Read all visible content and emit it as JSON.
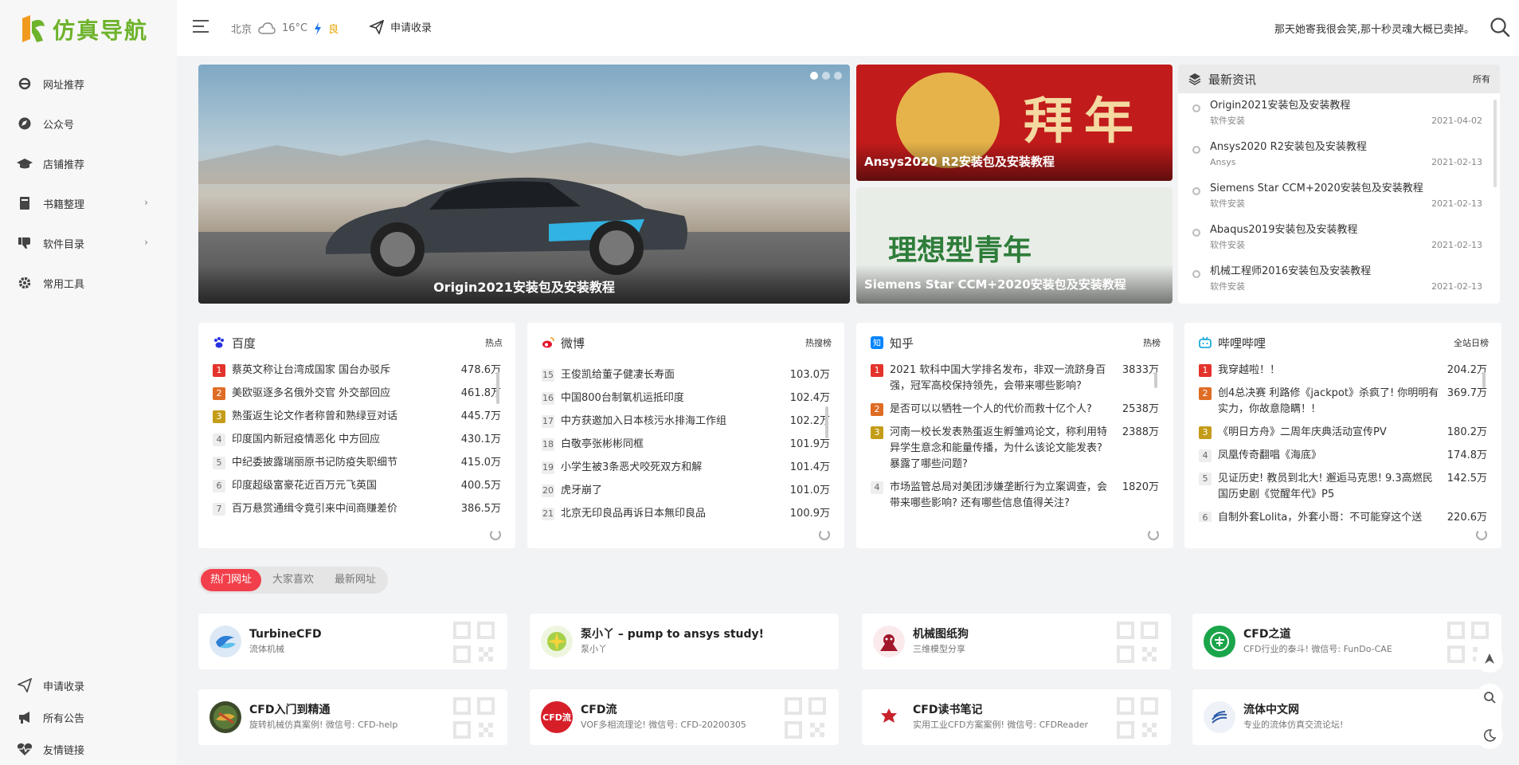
{
  "brand": {
    "name": "仿真导航"
  },
  "sidebar": {
    "items": [
      {
        "label": "网址推荐",
        "icon": "ie-icon"
      },
      {
        "label": "公众号",
        "icon": "compass-icon"
      },
      {
        "label": "店铺推荐",
        "icon": "graduation-cap-icon"
      },
      {
        "label": "书籍整理",
        "icon": "book-icon",
        "chevron": true
      },
      {
        "label": "软件目录",
        "icon": "thumbs-down-icon",
        "chevron": true
      },
      {
        "label": "常用工具",
        "icon": "gear-icon"
      }
    ],
    "bottom": [
      {
        "label": "申请收录",
        "icon": "paper-plane-icon"
      },
      {
        "label": "所有公告",
        "icon": "bullhorn-icon"
      },
      {
        "label": "友情链接",
        "icon": "heartbeat-icon"
      }
    ]
  },
  "header": {
    "city": "北京",
    "temp": "16°C",
    "air": "良",
    "apply": "申请收录",
    "quote": "那天她寄我很会笑,那十秒灵魂大概已卖掉。"
  },
  "hero": {
    "slide_caption": "Origin2021安装包及安装教程",
    "tile1_caption": "Ansys2020 R2安装包及安装教程",
    "tile1_art": "拜年",
    "tile2_caption": "Siemens Star CCM+2020安装包及安装教程",
    "tile2_art": "理想型青年"
  },
  "news": {
    "title": "最新资讯",
    "more": "所有",
    "items": [
      {
        "title": "Origin2021安装包及安装教程",
        "cat": "软件安装",
        "date": "2021-04-02"
      },
      {
        "title": "Ansys2020 R2安装包及安装教程",
        "cat": "Ansys",
        "date": "2021-02-13"
      },
      {
        "title": "Siemens Star CCM+2020安装包及安装教程",
        "cat": "软件安装",
        "date": "2021-02-13"
      },
      {
        "title": "Abaqus2019安装包及安装教程",
        "cat": "软件安装",
        "date": "2021-02-13"
      },
      {
        "title": "机械工程师2016安装包及安装教程",
        "cat": "软件安装",
        "date": "2021-02-13"
      }
    ]
  },
  "boards": [
    {
      "name": "百度",
      "tag": "热点",
      "color": "#2932e1",
      "rows": [
        {
          "n": "1",
          "t": "蔡英文称让台湾成国家 国台办驳斥",
          "v": "478.6万"
        },
        {
          "n": "2",
          "t": "美欧驱逐多名俄外交官 外交部回应",
          "v": "461.8万"
        },
        {
          "n": "3",
          "t": "熟蛋返生论文作者称曾和熟绿豆对话",
          "v": "445.7万"
        },
        {
          "n": "4",
          "t": "印度国内新冠疫情恶化 中方回应",
          "v": "430.1万"
        },
        {
          "n": "5",
          "t": "中纪委披露瑞丽原书记防疫失职细节",
          "v": "415.0万"
        },
        {
          "n": "6",
          "t": "印度超级富豪花近百万元飞英国",
          "v": "400.5万"
        },
        {
          "n": "7",
          "t": "百万悬赏通缉令竟引来中间商赚差价",
          "v": "386.5万"
        }
      ]
    },
    {
      "name": "微博",
      "tag": "热搜榜",
      "color": "#e6162d",
      "rows": [
        {
          "n": "15",
          "t": "王俊凯给董子健凄长寿面",
          "v": "103.0万"
        },
        {
          "n": "16",
          "t": "中国800台制氧机运抵印度",
          "v": "102.4万"
        },
        {
          "n": "17",
          "t": "中方获邀加入日本核污水排海工作组",
          "v": "102.2万"
        },
        {
          "n": "18",
          "t": "白敬亭张彬彬同框",
          "v": "101.9万"
        },
        {
          "n": "19",
          "t": "小学生被3条恶犬咬死双方和解",
          "v": "101.4万"
        },
        {
          "n": "20",
          "t": "虎牙崩了",
          "v": "101.0万"
        },
        {
          "n": "21",
          "t": "北京无印良品再诉日本無印良品",
          "v": "100.9万"
        }
      ]
    },
    {
      "name": "知乎",
      "tag": "热榜",
      "color": "#0084ff",
      "rows": [
        {
          "n": "1",
          "t": "2021 软科中国大学排名发布，非双一流跻身百强，冠军高校保持领先，会带来哪些影响?",
          "v": "3833万"
        },
        {
          "n": "2",
          "t": "是否可以以牺牲一个人的代价而救十亿个人?",
          "v": "2538万"
        },
        {
          "n": "3",
          "t": "河南一校长发表熟蛋返生孵雏鸡论文，称利用特异学生意念和能量传播，为什么该论文能发表? 暴露了哪些问题?",
          "v": "2388万"
        },
        {
          "n": "4",
          "t": "市场监管总局对美团涉嫌垄断行为立案调查，会带来哪些影响? 还有哪些信息值得关注?",
          "v": "1820万"
        }
      ]
    },
    {
      "name": "哔哩哔哩",
      "tag": "全站日榜",
      "color": "#00a1d6",
      "rows": [
        {
          "n": "1",
          "t": "我穿越啦！！",
          "v": "204.2万"
        },
        {
          "n": "2",
          "t": "创4总决赛 利路修《jackpot》杀疯了! 你明明有实力，你故意隐瞒！!",
          "v": "369.7万"
        },
        {
          "n": "3",
          "t": "《明日方舟》二周年庆典活动宣传PV",
          "v": "180.2万"
        },
        {
          "n": "4",
          "t": "凤凰传奇翻唱《海底》",
          "v": "174.8万"
        },
        {
          "n": "5",
          "t": "见证历史! 教员到北大! 邂逅马克思! 9.3高燃民国历史剧《觉醒年代》P5",
          "v": "142.5万"
        },
        {
          "n": "6",
          "t": "自制外套Lolita，外套小哥：不可能穿这个送",
          "v": "220.6万"
        }
      ]
    }
  ],
  "tabs": [
    "热门网址",
    "大家喜欢",
    "最新网址"
  ],
  "sites": [
    {
      "name": "TurbineCFD",
      "desc": "流体机械",
      "color": "#3a7bd5"
    },
    {
      "name": "泵小丫 – pump to ansys study!",
      "desc": "泵小丫",
      "color": "#8bc34a"
    },
    {
      "name": "机械图纸狗",
      "desc": "三维模型分享",
      "color": "#a0182a"
    },
    {
      "name": "CFD之道",
      "desc": "CFD行业的泰斗! 微信号: FunDo-CAE",
      "color": "#1ba54a"
    },
    {
      "name": "CFD入门到精通",
      "desc": "旋转机械仿真案例! 微信号: CFD-help",
      "color": "#5b7a3a"
    },
    {
      "name": "CFD流",
      "desc": "VOF多相流理论! 微信号: CFD-20200305",
      "color": "#d71f2a",
      "mark": "CFD流"
    },
    {
      "name": "CFD读书笔记",
      "desc": "实用工业CFD方案案例! 微信号: CFDReader",
      "color": "#c8232c"
    },
    {
      "name": "流体中文网",
      "desc": "专业的流体仿真交流论坛!",
      "color": "#2d5aa8"
    }
  ]
}
